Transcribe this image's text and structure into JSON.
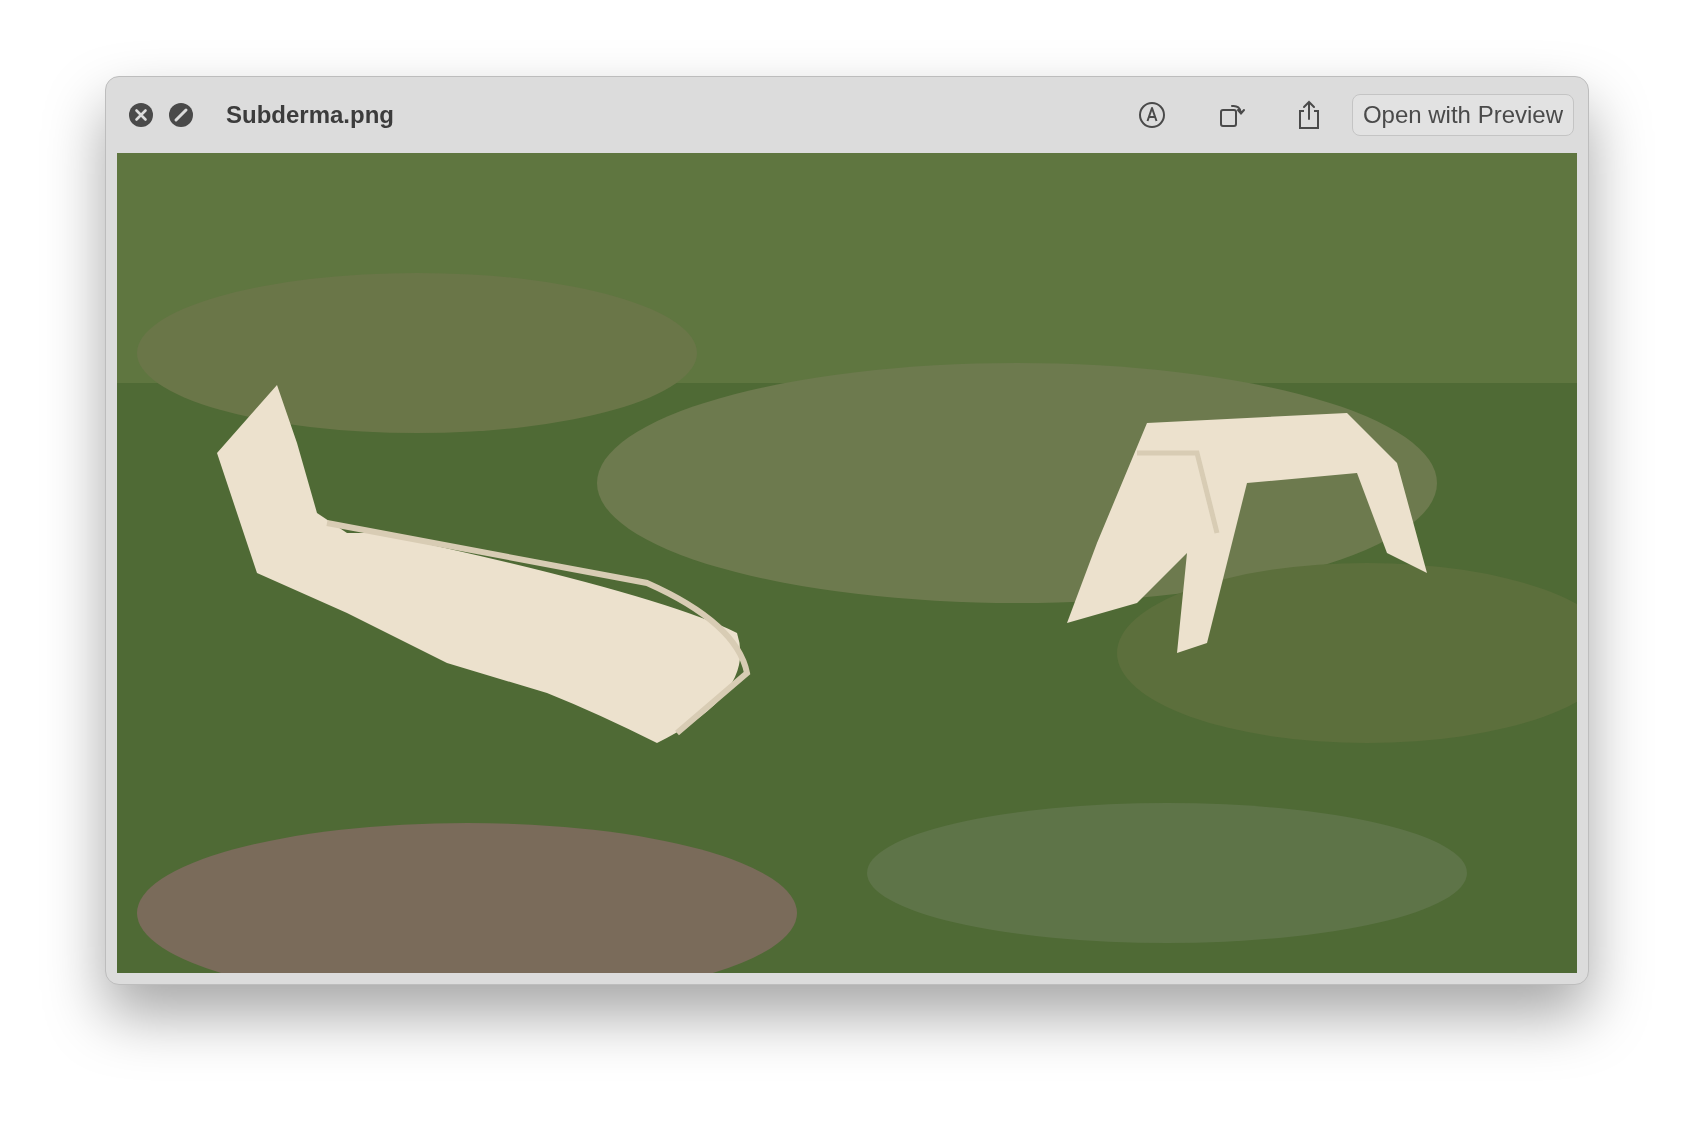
{
  "window": {
    "title": "Subderma.png"
  },
  "toolbar": {
    "open_button": "Open with Preview"
  }
}
